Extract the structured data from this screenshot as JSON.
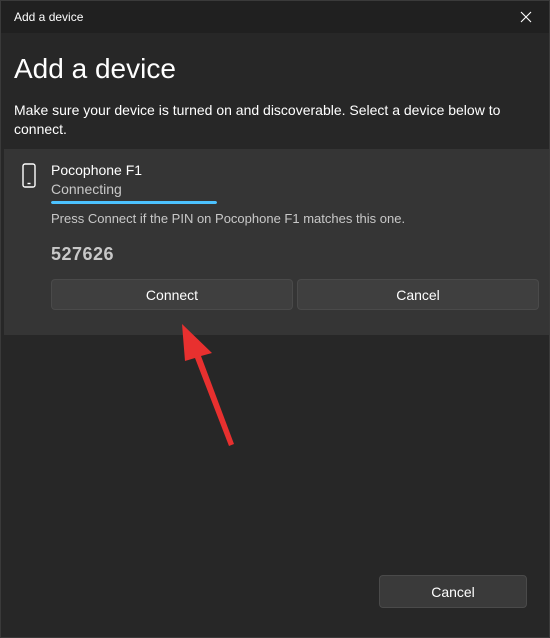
{
  "window": {
    "title": "Add a device"
  },
  "page": {
    "heading": "Add a device",
    "description": "Make sure your device is turned on and discoverable. Select a device below to connect."
  },
  "device": {
    "icon": "phone-icon",
    "name": "Pocophone F1",
    "status": "Connecting",
    "pin_instruction": "Press Connect if the PIN on Pocophone F1 matches this one.",
    "pin": "527626",
    "connect_label": "Connect",
    "cancel_label": "Cancel"
  },
  "footer": {
    "cancel_label": "Cancel"
  },
  "colors": {
    "accent": "#4cc2ff",
    "annotation": "#e8302f"
  }
}
